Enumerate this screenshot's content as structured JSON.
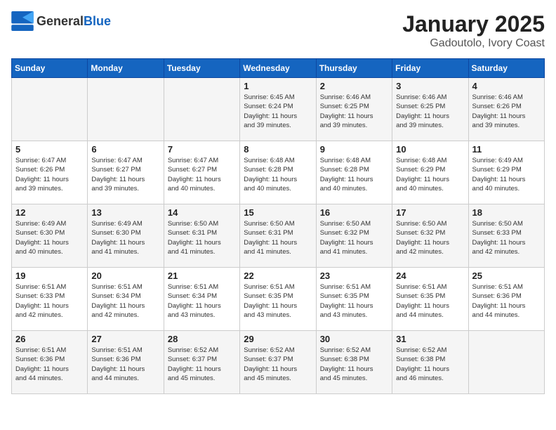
{
  "header": {
    "logo": {
      "general": "General",
      "blue": "Blue"
    },
    "title": "January 2025",
    "subtitle": "Gadoutolo, Ivory Coast"
  },
  "weekdays": [
    "Sunday",
    "Monday",
    "Tuesday",
    "Wednesday",
    "Thursday",
    "Friday",
    "Saturday"
  ],
  "weeks": [
    [
      {
        "day": "",
        "info": ""
      },
      {
        "day": "",
        "info": ""
      },
      {
        "day": "",
        "info": ""
      },
      {
        "day": "1",
        "info": "Sunrise: 6:45 AM\nSunset: 6:24 PM\nDaylight: 11 hours\nand 39 minutes."
      },
      {
        "day": "2",
        "info": "Sunrise: 6:46 AM\nSunset: 6:25 PM\nDaylight: 11 hours\nand 39 minutes."
      },
      {
        "day": "3",
        "info": "Sunrise: 6:46 AM\nSunset: 6:25 PM\nDaylight: 11 hours\nand 39 minutes."
      },
      {
        "day": "4",
        "info": "Sunrise: 6:46 AM\nSunset: 6:26 PM\nDaylight: 11 hours\nand 39 minutes."
      }
    ],
    [
      {
        "day": "5",
        "info": "Sunrise: 6:47 AM\nSunset: 6:26 PM\nDaylight: 11 hours\nand 39 minutes."
      },
      {
        "day": "6",
        "info": "Sunrise: 6:47 AM\nSunset: 6:27 PM\nDaylight: 11 hours\nand 39 minutes."
      },
      {
        "day": "7",
        "info": "Sunrise: 6:47 AM\nSunset: 6:27 PM\nDaylight: 11 hours\nand 40 minutes."
      },
      {
        "day": "8",
        "info": "Sunrise: 6:48 AM\nSunset: 6:28 PM\nDaylight: 11 hours\nand 40 minutes."
      },
      {
        "day": "9",
        "info": "Sunrise: 6:48 AM\nSunset: 6:28 PM\nDaylight: 11 hours\nand 40 minutes."
      },
      {
        "day": "10",
        "info": "Sunrise: 6:48 AM\nSunset: 6:29 PM\nDaylight: 11 hours\nand 40 minutes."
      },
      {
        "day": "11",
        "info": "Sunrise: 6:49 AM\nSunset: 6:29 PM\nDaylight: 11 hours\nand 40 minutes."
      }
    ],
    [
      {
        "day": "12",
        "info": "Sunrise: 6:49 AM\nSunset: 6:30 PM\nDaylight: 11 hours\nand 40 minutes."
      },
      {
        "day": "13",
        "info": "Sunrise: 6:49 AM\nSunset: 6:30 PM\nDaylight: 11 hours\nand 41 minutes."
      },
      {
        "day": "14",
        "info": "Sunrise: 6:50 AM\nSunset: 6:31 PM\nDaylight: 11 hours\nand 41 minutes."
      },
      {
        "day": "15",
        "info": "Sunrise: 6:50 AM\nSunset: 6:31 PM\nDaylight: 11 hours\nand 41 minutes."
      },
      {
        "day": "16",
        "info": "Sunrise: 6:50 AM\nSunset: 6:32 PM\nDaylight: 11 hours\nand 41 minutes."
      },
      {
        "day": "17",
        "info": "Sunrise: 6:50 AM\nSunset: 6:32 PM\nDaylight: 11 hours\nand 42 minutes."
      },
      {
        "day": "18",
        "info": "Sunrise: 6:50 AM\nSunset: 6:33 PM\nDaylight: 11 hours\nand 42 minutes."
      }
    ],
    [
      {
        "day": "19",
        "info": "Sunrise: 6:51 AM\nSunset: 6:33 PM\nDaylight: 11 hours\nand 42 minutes."
      },
      {
        "day": "20",
        "info": "Sunrise: 6:51 AM\nSunset: 6:34 PM\nDaylight: 11 hours\nand 42 minutes."
      },
      {
        "day": "21",
        "info": "Sunrise: 6:51 AM\nSunset: 6:34 PM\nDaylight: 11 hours\nand 43 minutes."
      },
      {
        "day": "22",
        "info": "Sunrise: 6:51 AM\nSunset: 6:35 PM\nDaylight: 11 hours\nand 43 minutes."
      },
      {
        "day": "23",
        "info": "Sunrise: 6:51 AM\nSunset: 6:35 PM\nDaylight: 11 hours\nand 43 minutes."
      },
      {
        "day": "24",
        "info": "Sunrise: 6:51 AM\nSunset: 6:35 PM\nDaylight: 11 hours\nand 44 minutes."
      },
      {
        "day": "25",
        "info": "Sunrise: 6:51 AM\nSunset: 6:36 PM\nDaylight: 11 hours\nand 44 minutes."
      }
    ],
    [
      {
        "day": "26",
        "info": "Sunrise: 6:51 AM\nSunset: 6:36 PM\nDaylight: 11 hours\nand 44 minutes."
      },
      {
        "day": "27",
        "info": "Sunrise: 6:51 AM\nSunset: 6:36 PM\nDaylight: 11 hours\nand 44 minutes."
      },
      {
        "day": "28",
        "info": "Sunrise: 6:52 AM\nSunset: 6:37 PM\nDaylight: 11 hours\nand 45 minutes."
      },
      {
        "day": "29",
        "info": "Sunrise: 6:52 AM\nSunset: 6:37 PM\nDaylight: 11 hours\nand 45 minutes."
      },
      {
        "day": "30",
        "info": "Sunrise: 6:52 AM\nSunset: 6:38 PM\nDaylight: 11 hours\nand 45 minutes."
      },
      {
        "day": "31",
        "info": "Sunrise: 6:52 AM\nSunset: 6:38 PM\nDaylight: 11 hours\nand 46 minutes."
      },
      {
        "day": "",
        "info": ""
      }
    ]
  ]
}
